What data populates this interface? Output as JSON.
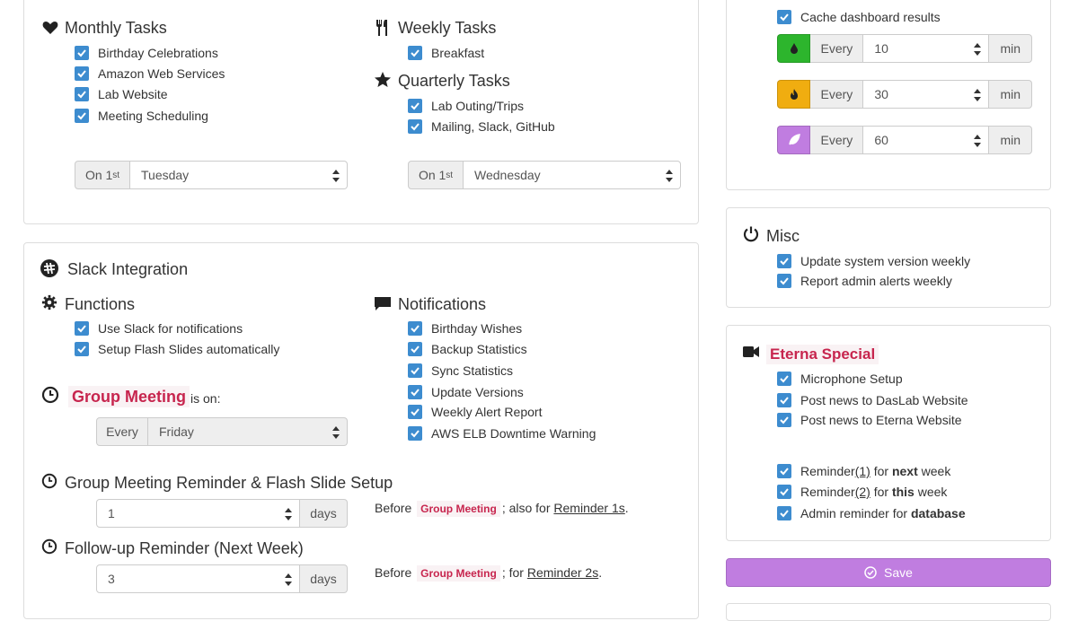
{
  "monthly": {
    "title": "Monthly Tasks",
    "items": [
      "Birthday Celebrations",
      "Amazon Web Services",
      "Lab Website",
      "Meeting Scheduling"
    ],
    "on_label": "On 1",
    "on_sup": "st",
    "day": "Tuesday"
  },
  "weekly": {
    "title": "Weekly Tasks",
    "items": [
      "Breakfast"
    ]
  },
  "quarterly": {
    "title": "Quarterly Tasks",
    "items": [
      "Lab Outing/Trips",
      "Mailing, Slack, GitHub"
    ],
    "on_label": "On 1",
    "on_sup": "st",
    "day": "Wednesday"
  },
  "slack": {
    "title": "Slack Integration",
    "functions_title": "Functions",
    "functions": [
      "Use Slack for notifications",
      "Setup Flash Slides automatically"
    ],
    "notifications_title": "Notifications",
    "notifications": [
      "Birthday Wishes",
      "Backup Statistics",
      "Sync Statistics",
      "Update Versions",
      "Weekly Alert Report",
      "AWS ELB Downtime Warning"
    ]
  },
  "group_meeting": {
    "tag": "Group Meeting",
    "is_on": "is on:",
    "every": "Every",
    "day": "Friday"
  },
  "reminder_setup": {
    "title": "Group Meeting Reminder & Flash Slide Setup",
    "value": "1",
    "unit": "days",
    "before": "Before",
    "tag": "Group Meeting",
    "also": "; also for",
    "link": "Reminder 1s",
    "period": "."
  },
  "followup": {
    "title": "Follow-up Reminder (Next Week)",
    "value": "3",
    "unit": "days",
    "before": "Before",
    "tag": "Group Meeting",
    "for": "; for",
    "link": "Reminder 2s",
    "period": "."
  },
  "cache": {
    "label": "Cache dashboard results",
    "rows": [
      {
        "every": "Every",
        "value": "10",
        "unit": "min",
        "color": "#2db52d"
      },
      {
        "every": "Every",
        "value": "30",
        "unit": "min",
        "color": "#f0ad10"
      },
      {
        "every": "Every",
        "value": "60",
        "unit": "min",
        "color": "#c07de0"
      }
    ]
  },
  "misc": {
    "title": "Misc",
    "items": [
      "Update system version weekly",
      "Report admin alerts weekly"
    ]
  },
  "eterna": {
    "title": "Eterna Special",
    "items": [
      "Microphone Setup",
      "Post news to DasLab Website",
      "Post news to Eterna Website"
    ],
    "r1_pre": "Reminder",
    "r1_link": "(1)",
    "r1_mid": " for ",
    "r1_bold": "next",
    "r1_post": " week",
    "r2_pre": "Reminder",
    "r2_link": "(2)",
    "r2_mid": " for ",
    "r2_bold": "this",
    "r2_post": " week",
    "r3_pre": "Admin reminder for ",
    "r3_bold": "database"
  },
  "save_label": "Save",
  "colors": {
    "checkbox": "#3d8ccf",
    "accent_tag": "#c7254e",
    "save": "#c07de0"
  }
}
